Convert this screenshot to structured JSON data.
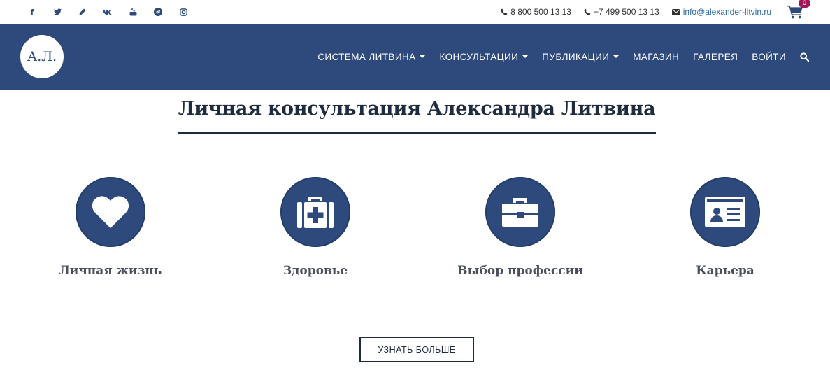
{
  "topbar": {
    "social": [
      {
        "name": "facebook-icon",
        "glyph": "f"
      },
      {
        "name": "twitter-icon",
        "glyph": ""
      },
      {
        "name": "pencil-icon",
        "glyph": ""
      },
      {
        "name": "vk-icon",
        "glyph": "vk"
      },
      {
        "name": "youtube-icon",
        "glyph": ""
      },
      {
        "name": "telegram-icon",
        "glyph": ""
      },
      {
        "name": "instagram-icon",
        "glyph": ""
      }
    ],
    "phone1": "8 800 500 13 13",
    "phone2": "+7 499 500 13 13",
    "email": "info@alexander-litvin.ru",
    "cart_count": "0"
  },
  "navbar": {
    "logo_text": "А.Л.",
    "menu": [
      {
        "label": "СИСТЕМА ЛИТВИНА",
        "dropdown": true
      },
      {
        "label": "КОНСУЛЬТАЦИИ",
        "dropdown": true
      },
      {
        "label": "ПУБЛИКАЦИИ",
        "dropdown": true
      },
      {
        "label": "МАГАЗИН",
        "dropdown": false
      },
      {
        "label": "ГАЛЕРЕЯ",
        "dropdown": false
      },
      {
        "label": "ВОЙТИ",
        "dropdown": false
      }
    ]
  },
  "main": {
    "title": "Личная консультация Александра Литвина",
    "features": [
      {
        "label": "Личная жизнь",
        "icon": "heart-icon"
      },
      {
        "label": "Здоровье",
        "icon": "first-aid-kit-icon"
      },
      {
        "label": "Выбор профессии",
        "icon": "briefcase-icon"
      },
      {
        "label": "Карьера",
        "icon": "id-card-icon"
      }
    ],
    "more_button": "УЗНАТЬ БОЛЬШЕ"
  },
  "colors": {
    "nav_bg": "#2e4a7c",
    "heading": "#1f2b3e",
    "badge": "#a0185a",
    "link": "#2b6aa6"
  }
}
